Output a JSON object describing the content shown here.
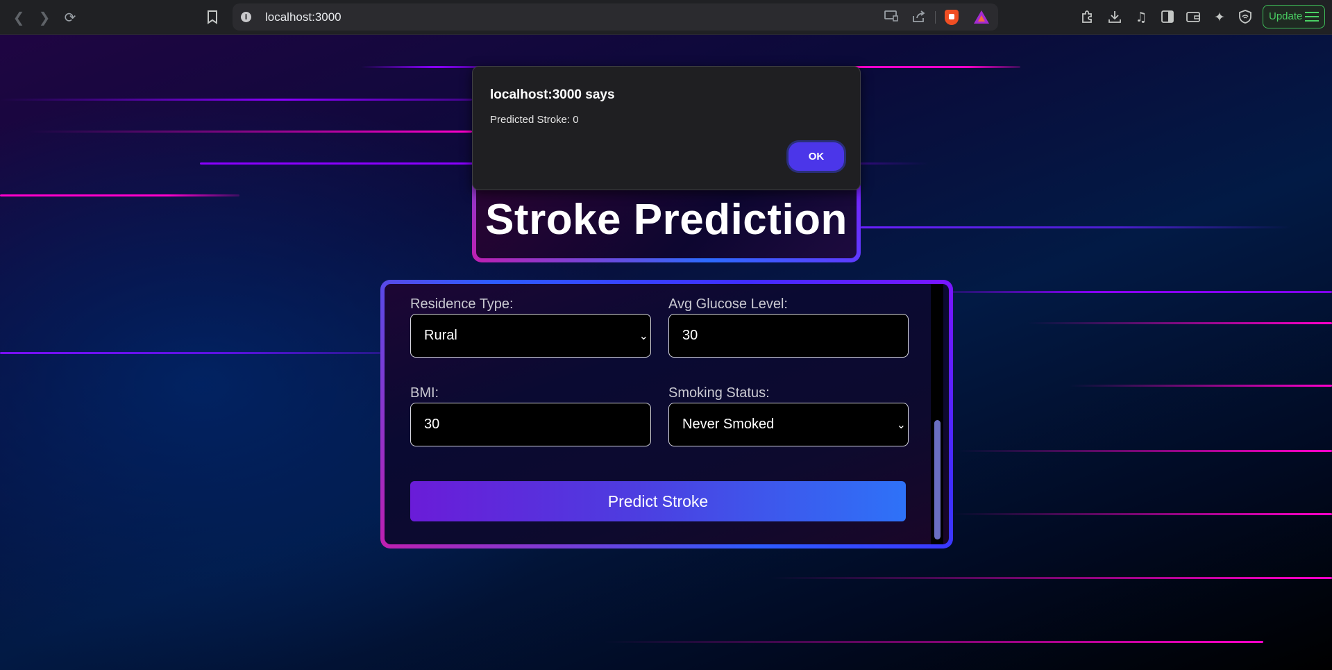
{
  "browser": {
    "url": "localhost:3000",
    "update_label": "Update"
  },
  "dialog": {
    "title": "localhost:3000 says",
    "message": "Predicted Stroke: 0",
    "ok_label": "OK"
  },
  "page": {
    "title": "Stroke Prediction",
    "form": {
      "residence_type": {
        "label": "Residence Type:",
        "value": "Rural"
      },
      "avg_glucose_level": {
        "label": "Avg Glucose Level:",
        "value": "30"
      },
      "bmi": {
        "label": "BMI:",
        "value": "30"
      },
      "smoking_status": {
        "label": "Smoking Status:",
        "value": "Never Smoked"
      },
      "submit_label": "Predict Stroke"
    }
  },
  "colors": {
    "accent_magenta": "#ff00cc",
    "accent_purple": "#8a00ff",
    "button_gradient_start": "#6a1cd8",
    "button_gradient_end": "#2e72f8",
    "dialog_ok": "#4b36e9",
    "update_green": "#4ad164"
  },
  "icons": [
    "back-icon",
    "forward-icon",
    "reload-icon",
    "bookmark-icon",
    "site-info-icon",
    "cast-icon",
    "share-icon",
    "brave-shield-icon",
    "brave-rewards-icon",
    "extensions-icon",
    "downloads-icon",
    "media-icon",
    "sidebar-icon",
    "wallet-icon",
    "leo-ai-icon",
    "vpn-icon",
    "menu-icon"
  ]
}
